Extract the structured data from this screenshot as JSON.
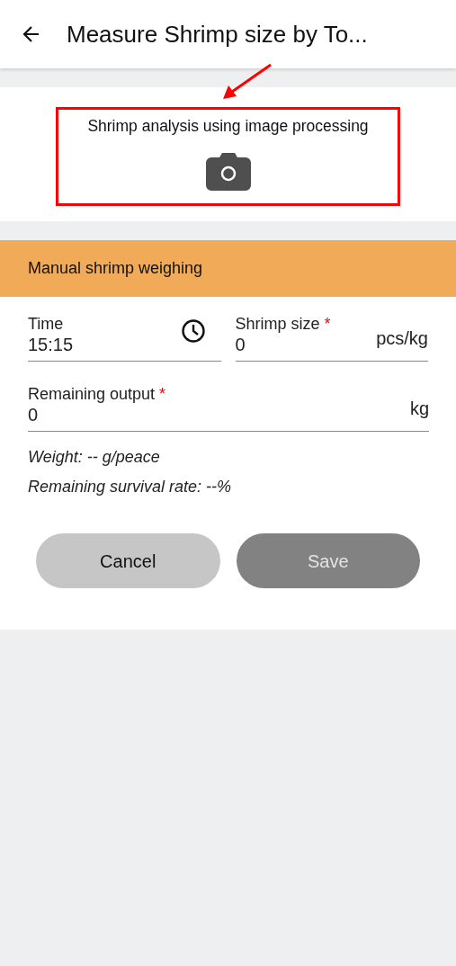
{
  "header": {
    "title": "Measure Shrimp size by To..."
  },
  "image_analysis": {
    "label": "Shrimp analysis using image processing"
  },
  "manual": {
    "title": "Manual shrimp weighing",
    "fields": [
      {
        "kind": "time",
        "label": "Time",
        "value": "15:15"
      },
      {
        "kind": "number",
        "label": "Shrimp size",
        "required_mark": "*",
        "value": "0",
        "unit": "pcs/kg"
      },
      {
        "kind": "number",
        "label": "Remaining output",
        "required_mark": "*",
        "value": "0",
        "unit": "kg"
      }
    ],
    "notes": [
      "Weight: -- g/peace",
      "Remaining survival rate: --%"
    ],
    "buttons": [
      {
        "label": "Cancel",
        "disabled": false
      },
      {
        "label": "Save",
        "disabled": true
      }
    ]
  }
}
